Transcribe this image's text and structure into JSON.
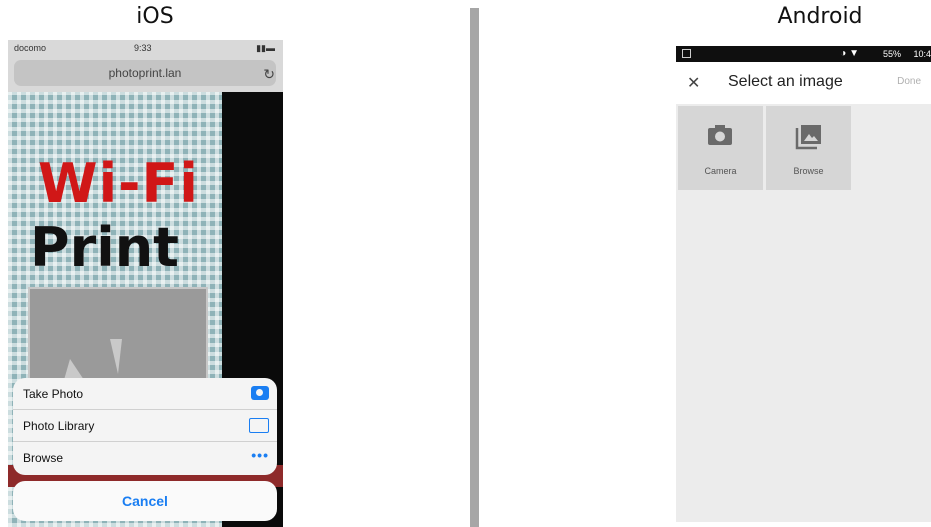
{
  "labels": {
    "ios": "iOS",
    "android": "Android"
  },
  "ios": {
    "status": {
      "carrier": "docomo",
      "time": "9:33"
    },
    "url": "photoprint.lan",
    "page": {
      "title_line1": "Wi-Fi",
      "title_line2": "Print"
    },
    "action_sheet": {
      "items": [
        {
          "label": "Take Photo",
          "icon": "camera-icon"
        },
        {
          "label": "Photo Library",
          "icon": "photo-library-icon"
        },
        {
          "label": "Browse",
          "icon": "more-dots-icon"
        }
      ],
      "cancel_label": "Cancel"
    },
    "accent_color": "#1a7ef2"
  },
  "android": {
    "status": {
      "battery": "55%",
      "time": "10:4"
    },
    "toolbar": {
      "close_icon": "close-icon",
      "title": "Select an image",
      "done_label": "Done"
    },
    "tiles": [
      {
        "label": "Camera",
        "icon": "camera-icon"
      },
      {
        "label": "Browse",
        "icon": "gallery-icon"
      }
    ]
  }
}
